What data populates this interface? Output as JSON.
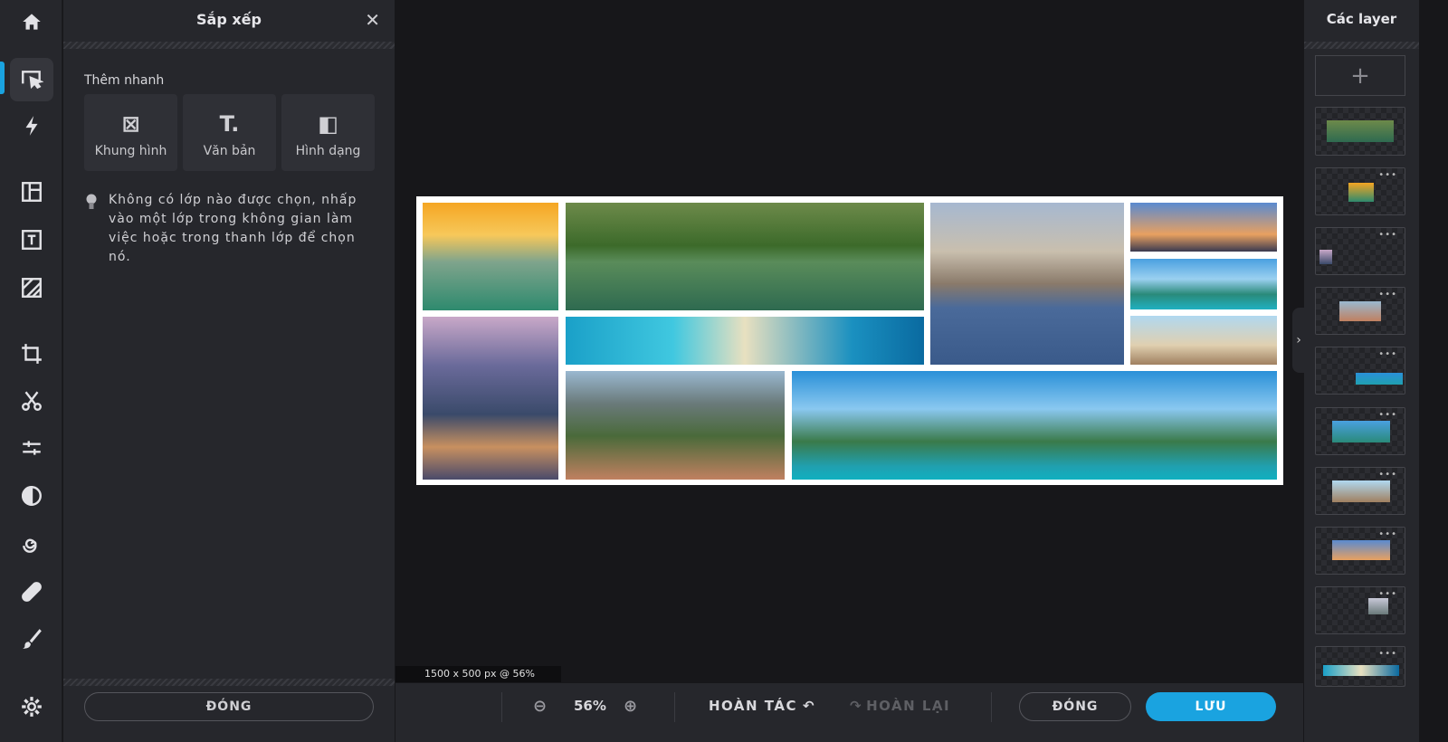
{
  "toolbar": {
    "items": [
      "home",
      "arrange",
      "quick-effects",
      "layout",
      "text",
      "texture",
      "crop",
      "cutout",
      "adjust",
      "filter",
      "effect",
      "retouch",
      "brush",
      "settings"
    ],
    "active": "arrange"
  },
  "panel": {
    "title": "Sắp xếp",
    "quick_add_label": "Thêm nhanh",
    "quick_add": [
      {
        "label": "Khung hình",
        "icon": "frame-icon"
      },
      {
        "label": "Văn bản",
        "icon": "text-icon"
      },
      {
        "label": "Hình dạng",
        "icon": "shape-icon"
      }
    ],
    "hint": "Không có lớp nào được chọn, nhấp vào một lớp trong không gian làm việc hoặc trong thanh lớp để chọn nó.",
    "close_label": "ĐÓNG"
  },
  "canvas": {
    "size_info": "1500 x 500 px @ 56%"
  },
  "bottombar": {
    "zoom": "56%",
    "undo": "HOÀN TÁC",
    "redo": "HOÀN LẠI",
    "close": "ĐÓNG",
    "save": "LƯU"
  },
  "layers": {
    "title": "Các layer",
    "add": "+",
    "count": 10
  },
  "colors": {
    "accent": "#1aa3e0",
    "panel": "#26272c",
    "canvas": "#17171a"
  }
}
